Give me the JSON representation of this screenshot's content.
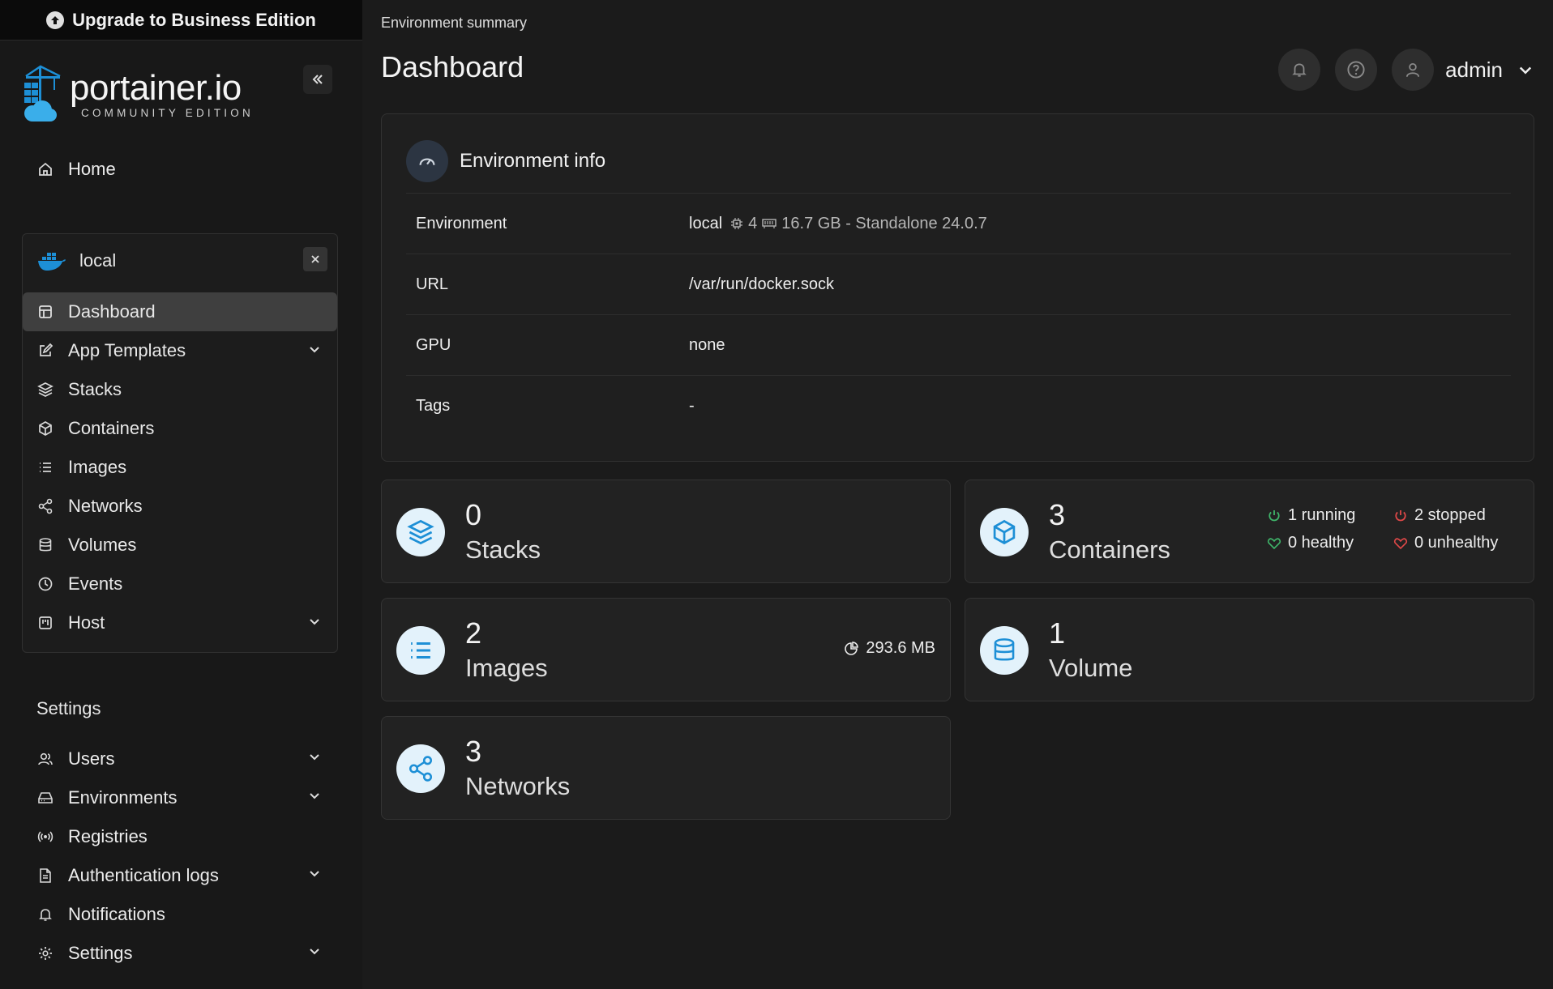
{
  "sidebar": {
    "upgrade_label": "Upgrade to Business Edition",
    "brand_name": "portainer.io",
    "brand_sub": "COMMUNITY EDITION",
    "home_label": "Home",
    "environment": {
      "name": "local",
      "items": [
        {
          "label": "Dashboard",
          "icon": "dashboard-icon",
          "active": true
        },
        {
          "label": "App Templates",
          "icon": "edit-icon",
          "expandable": true
        },
        {
          "label": "Stacks",
          "icon": "layers-icon"
        },
        {
          "label": "Containers",
          "icon": "box-icon"
        },
        {
          "label": "Images",
          "icon": "list-icon"
        },
        {
          "label": "Networks",
          "icon": "share-icon"
        },
        {
          "label": "Volumes",
          "icon": "database-icon"
        },
        {
          "label": "Events",
          "icon": "clock-icon"
        },
        {
          "label": "Host",
          "icon": "host-icon",
          "expandable": true
        }
      ]
    },
    "settings_title": "Settings",
    "settings_items": [
      {
        "label": "Users",
        "icon": "users-icon",
        "expandable": true
      },
      {
        "label": "Environments",
        "icon": "drive-icon",
        "expandable": true
      },
      {
        "label": "Registries",
        "icon": "radio-icon"
      },
      {
        "label": "Authentication logs",
        "icon": "file-icon",
        "expandable": true
      },
      {
        "label": "Notifications",
        "icon": "bell-icon"
      },
      {
        "label": "Settings",
        "icon": "gear-icon",
        "expandable": true
      }
    ]
  },
  "header": {
    "breadcrumb": "Environment summary",
    "title": "Dashboard",
    "user": "admin"
  },
  "env_info": {
    "title": "Environment info",
    "rows": {
      "environment": {
        "key": "Environment",
        "value": "local",
        "cpu": "4",
        "memory": "16.7 GB - Standalone 24.0.7"
      },
      "url": {
        "key": "URL",
        "value": "/var/run/docker.sock"
      },
      "gpu": {
        "key": "GPU",
        "value": "none"
      },
      "tags": {
        "key": "Tags",
        "value": "-"
      }
    }
  },
  "cards": {
    "stacks": {
      "count": "0",
      "label": "Stacks"
    },
    "containers": {
      "count": "3",
      "label": "Containers",
      "running": "1 running",
      "stopped": "2 stopped",
      "healthy": "0 healthy",
      "unhealthy": "0 unhealthy"
    },
    "images": {
      "count": "2",
      "label": "Images",
      "size": "293.6 MB"
    },
    "volumes": {
      "count": "1",
      "label": "Volume"
    },
    "networks": {
      "count": "3",
      "label": "Networks"
    }
  },
  "colors": {
    "accent": "#1d8fd6",
    "running": "#3fb56a",
    "stopped": "#e04848"
  }
}
